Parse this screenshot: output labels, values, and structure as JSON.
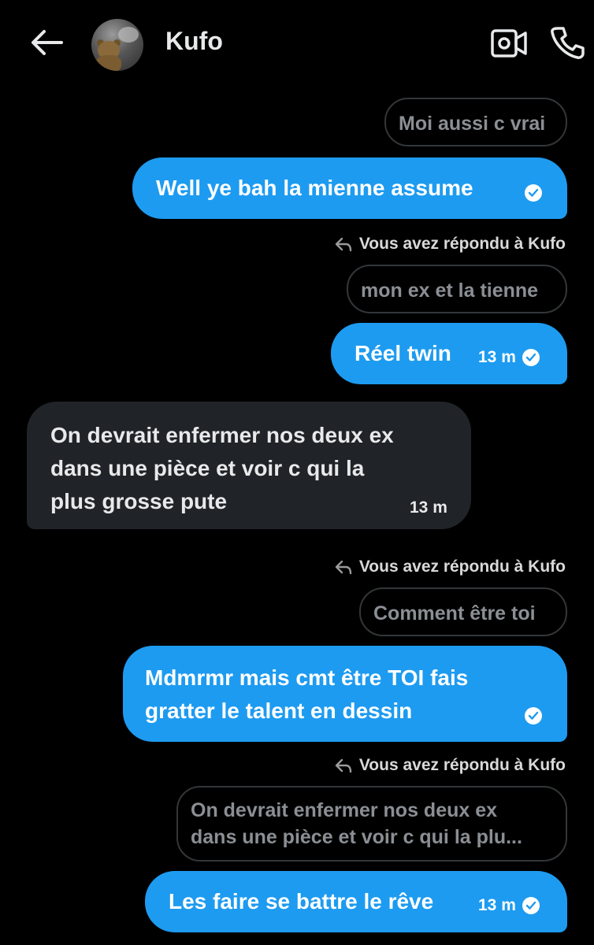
{
  "header": {
    "contact_name": "Kufo",
    "back_icon": "arrow-left-icon",
    "video_icon": "video-call-icon",
    "phone_icon": "phone-call-icon"
  },
  "messages": [
    {
      "type": "quoted",
      "text": "Moi aussi c vrai"
    },
    {
      "type": "sent",
      "text": "Well ye bah la mienne assume",
      "status": "read"
    },
    {
      "type": "reply_label",
      "text": "Vous avez répondu à Kufo"
    },
    {
      "type": "quoted",
      "text": "mon ex et la tienne"
    },
    {
      "type": "sent",
      "text": "Réel twin",
      "time": "13 m",
      "status": "read"
    },
    {
      "type": "received",
      "lines": [
        "On devrait enfermer nos deux ex",
        "dans une pièce et voir c qui la",
        "plus grosse pute"
      ],
      "time": "13 m"
    },
    {
      "type": "reply_label",
      "text": "Vous avez répondu à Kufo"
    },
    {
      "type": "quoted",
      "text": "Comment être toi"
    },
    {
      "type": "sent",
      "lines": [
        "Mdmrmr mais cmt être TOI fais",
        "gratter le talent en dessin"
      ],
      "status": "read"
    },
    {
      "type": "reply_label",
      "text": "Vous avez répondu à Kufo"
    },
    {
      "type": "quoted",
      "lines": [
        "On devrait enfermer nos deux ex",
        "dans une pièce et voir c qui la plu..."
      ]
    },
    {
      "type": "sent",
      "text": "Les faire se battre le rêve",
      "time": "13 m",
      "status": "read"
    }
  ],
  "colors": {
    "background": "#000000",
    "sent_bubble": "#1d9bf0",
    "received_bubble": "#202327",
    "quote_border": "#333639",
    "quote_text": "#8b8f94"
  }
}
